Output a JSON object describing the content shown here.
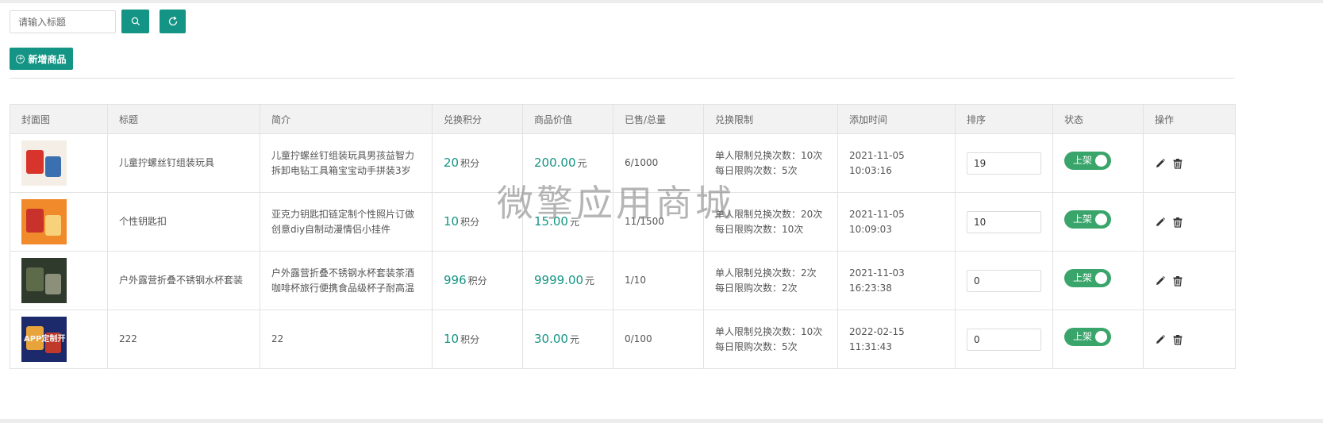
{
  "search": {
    "placeholder": "请输入标题"
  },
  "toolbar": {
    "add_label": "新增商品"
  },
  "table": {
    "columns": [
      "封面图",
      "标题",
      "简介",
      "兑换积分",
      "商品价值",
      "已售/总量",
      "兑换限制",
      "添加时间",
      "排序",
      "状态",
      "操作"
    ],
    "points_unit": "积分",
    "price_unit": "元",
    "rows": [
      {
        "title": "儿童拧螺丝钉组装玩具",
        "desc": "儿童拧螺丝钉组装玩具男孩益智力拆卸电钻工具箱宝宝动手拼装3岁",
        "points": "20",
        "price": "200.00",
        "sold_total": "6/1000",
        "limit_person": "单人限制兑换次数：10次",
        "limit_day": "每日限购次数：5次",
        "added": "2021-11-05 10:03:16",
        "sort": "19",
        "status": "上架",
        "thumb_colors": [
          "#f4eee6",
          "#d9342b",
          "#3a6fb0"
        ]
      },
      {
        "title": "个性钥匙扣",
        "desc": "亚克力钥匙扣链定制个性照片订做创意diy自制动漫情侣小挂件",
        "points": "10",
        "price": "15.00",
        "sold_total": "11/1500",
        "limit_person": "单人限制兑换次数：20次",
        "limit_day": "每日限购次数：10次",
        "added": "2021-11-05 10:09:03",
        "sort": "10",
        "status": "上架",
        "thumb_colors": [
          "#f08a2a",
          "#c8322a",
          "#f7d27a"
        ]
      },
      {
        "title": "户外露营折叠不锈钢水杯套装",
        "desc": "户外露营折叠不锈钢水杯套装茶酒咖啡杯旅行便携食品级杯子耐高温",
        "points": "996",
        "price": "9999.00",
        "sold_total": "1/10",
        "limit_person": "单人限制兑换次数：2次",
        "limit_day": "每日限购次数：2次",
        "added": "2021-11-03 16:23:38",
        "sort": "0",
        "status": "上架",
        "thumb_colors": [
          "#2f3a2c",
          "#5e6b4a",
          "#8c8f7a"
        ]
      },
      {
        "title": "222",
        "desc": "22",
        "points": "10",
        "price": "30.00",
        "sold_total": "0/100",
        "limit_person": "单人限制兑换次数：10次",
        "limit_day": "每日限购次数：5次",
        "added": "2022-02-15 11:31:43",
        "sort": "0",
        "status": "上架",
        "thumb_colors": [
          "#1c2a6b",
          "#e8a33a",
          "#c0392b"
        ],
        "thumb_text": "APP定制开"
      }
    ]
  },
  "watermark": "微擎应用商城",
  "colors": {
    "accent": "#149484",
    "switch_on": "#3aa56a",
    "header_bg": "#f2f2f2"
  }
}
